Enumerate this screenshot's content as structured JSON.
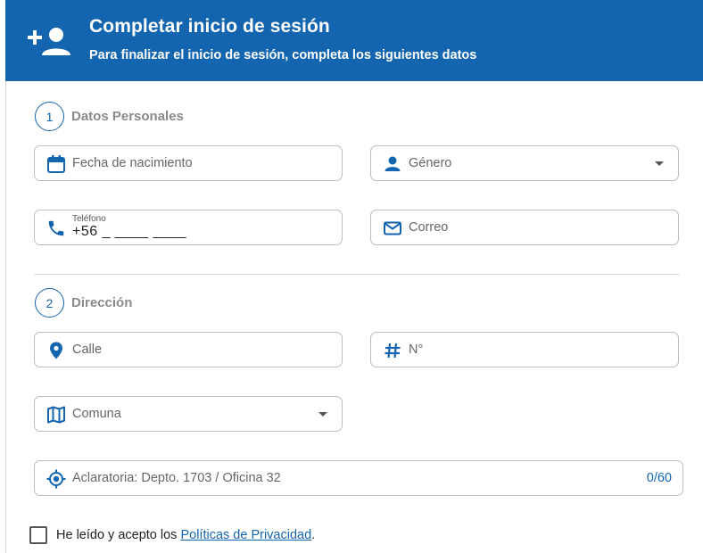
{
  "header": {
    "title": "Completar inicio de sesión",
    "subtitle": "Para finalizar el inicio de sesión, completa los siguientes datos",
    "icon": "add-user-icon"
  },
  "colors": {
    "primary": "#1465b0",
    "border": "#bdbdbd",
    "step_label": "#8a8a8a"
  },
  "section1": {
    "number": "1",
    "label": "Datos Personales",
    "birthdate": {
      "placeholder": "Fecha de nacimiento",
      "icon": "calendar-icon"
    },
    "gender": {
      "placeholder": "Género",
      "icon": "person-icon"
    },
    "phone": {
      "label": "Teléfono",
      "value": "+56 _ ____ ____",
      "icon": "phone-icon"
    },
    "email": {
      "placeholder": "Correo",
      "icon": "mail-icon"
    }
  },
  "section2": {
    "number": "2",
    "label": "Dirección",
    "street": {
      "placeholder": "Calle",
      "icon": "location-pin-icon"
    },
    "number_field": {
      "placeholder": "N°",
      "icon": "hash-icon"
    },
    "commune": {
      "placeholder": "Comuna",
      "icon": "map-icon"
    },
    "clarification": {
      "placeholder": "Aclaratoria: Depto. 1703 / Oficina 32",
      "counter": "0/60",
      "icon": "target-icon"
    }
  },
  "consent": {
    "text": "He leído y acepto los ",
    "link": "Políticas de Privacidad",
    "suffix": "."
  }
}
